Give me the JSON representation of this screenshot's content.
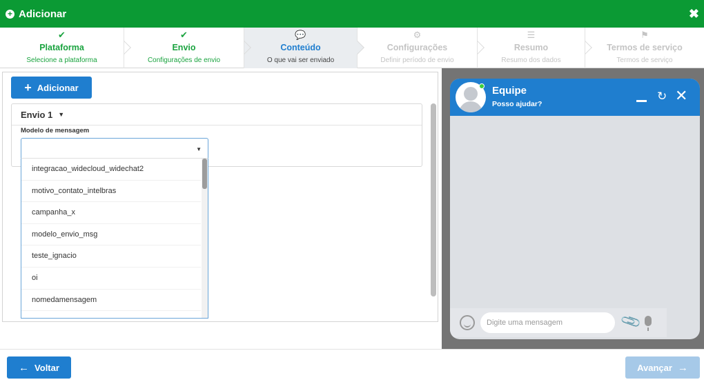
{
  "header": {
    "title": "Adicionar",
    "close_icon": "✖"
  },
  "steps": [
    {
      "icon": "✔",
      "title": "Plataforma",
      "subtitle": "Selecione a plataforma",
      "state": "done"
    },
    {
      "icon": "✔",
      "title": "Envio",
      "subtitle": "Configurações de envio",
      "state": "done"
    },
    {
      "icon": "💬",
      "title": "Conteúdo",
      "subtitle": "O que vai ser enviado",
      "state": "current"
    },
    {
      "icon": "⚙",
      "title": "Configurações",
      "subtitle": "Definir período de envio",
      "state": "todo"
    },
    {
      "icon": "☰",
      "title": "Resumo",
      "subtitle": "Resumo dos dados",
      "state": "todo"
    },
    {
      "icon": "⚑",
      "title": "Termos de serviço",
      "subtitle": "Termos de serviço",
      "state": "todo"
    }
  ],
  "content": {
    "add_label": "Adicionar",
    "envio_title": "Envio 1",
    "model_label": "Modelo de mensagem",
    "select_value": "",
    "options": [
      "integracao_widecloud_widechat2",
      "motivo_contato_intelbras",
      "campanha_x",
      "modelo_envio_msg",
      "teste_ignacio",
      "oi",
      "nomedamensagem"
    ]
  },
  "chat": {
    "name": "Equipe",
    "subtitle": "Posso ajudar?",
    "input_placeholder": "Digite uma mensagem",
    "accent": "#1f7ecf"
  },
  "footer": {
    "back_label": "Voltar",
    "next_label": "Avançar"
  },
  "colors": {
    "primary": "#1f7ecf",
    "success": "#0b9a34",
    "disabled": "#a6c9e8"
  }
}
